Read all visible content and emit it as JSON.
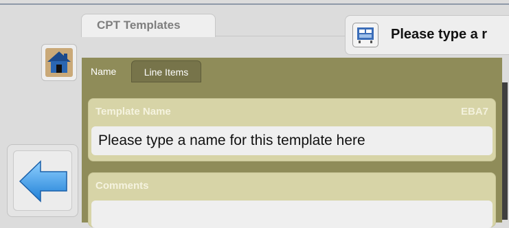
{
  "header": {
    "tab_label": "CPT Templates"
  },
  "status_bar": {
    "text": "Please type a r"
  },
  "tabs": [
    {
      "label": "Name",
      "active": true
    },
    {
      "label": "Line Items",
      "active": false
    }
  ],
  "template_name": {
    "label": "Template Name",
    "code": "EBA7",
    "value": "Please type a name for this template here"
  },
  "comments": {
    "label": "Comments",
    "value": ""
  },
  "colors": {
    "panel": "#8f8c59",
    "section": "#d7d4a7",
    "field": "#efefef",
    "back_arrow": "#2d8fe0"
  },
  "icons": {
    "home": "home-icon",
    "back": "back-arrow-icon",
    "status": "screen-icon"
  }
}
